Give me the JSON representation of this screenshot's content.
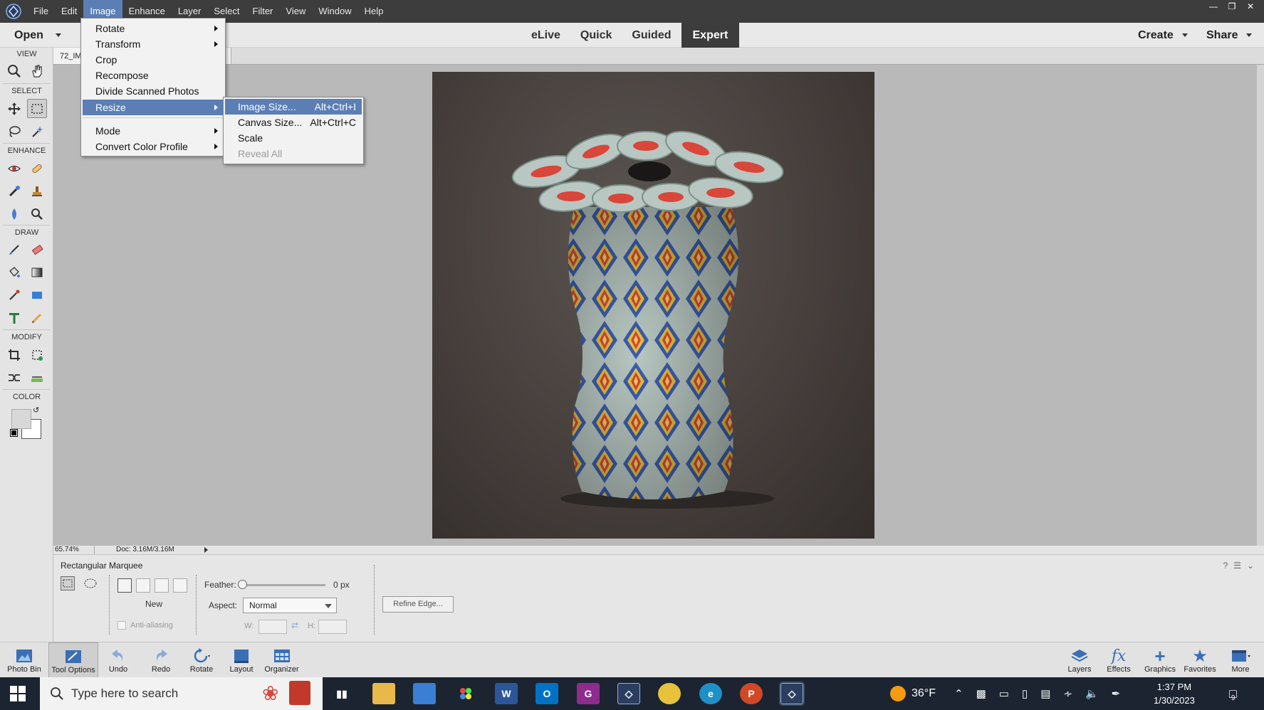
{
  "menubar": {
    "items": [
      "File",
      "Edit",
      "Image",
      "Enhance",
      "Layer",
      "Select",
      "Filter",
      "View",
      "Window",
      "Help"
    ],
    "active": "Image"
  },
  "modebar": {
    "open_label": "Open",
    "modes": [
      "eLive",
      "Quick",
      "Guided",
      "Expert"
    ],
    "active_mode": "Expert",
    "create_label": "Create",
    "share_label": "Share"
  },
  "toolbox": {
    "sections": {
      "view": "VIEW",
      "select": "SELECT",
      "enhance": "ENHANCE",
      "draw": "DRAW",
      "modify": "MODIFY",
      "color": "COLOR"
    }
  },
  "document": {
    "tab_label": "72_IM",
    "zoom": "65.74%",
    "doc_info": "Doc: 3.16M/3.16M"
  },
  "image_menu": {
    "items": [
      {
        "label": "Rotate",
        "submenu": true
      },
      {
        "label": "Transform",
        "submenu": true
      },
      {
        "label": "Crop",
        "submenu": false
      },
      {
        "label": "Recompose",
        "submenu": false
      },
      {
        "label": "Divide Scanned Photos",
        "submenu": false
      },
      {
        "label": "Resize",
        "submenu": true,
        "highlighted": true
      },
      {
        "label": "Mode",
        "submenu": true
      },
      {
        "label": "Convert Color Profile",
        "submenu": true
      }
    ]
  },
  "resize_menu": {
    "items": [
      {
        "label": "Image Size...",
        "shortcut": "Alt+Ctrl+I",
        "highlighted": true
      },
      {
        "label": "Canvas Size...",
        "shortcut": "Alt+Ctrl+C"
      },
      {
        "label": "Scale",
        "shortcut": ""
      },
      {
        "label": "Reveal All",
        "shortcut": "",
        "disabled": true
      }
    ]
  },
  "tool_options": {
    "tool_name": "Rectangular Marquee",
    "new_label": "New",
    "anti_alias_label": "Anti-aliasing",
    "feather_label": "Feather:",
    "feather_value": "0 px",
    "aspect_label": "Aspect:",
    "aspect_value": "Normal",
    "w_label": "W:",
    "h_label": "H:",
    "refine_label": "Refine Edge..."
  },
  "panelbar": {
    "left": [
      "Photo Bin",
      "Tool Options",
      "Undo",
      "Redo",
      "Rotate",
      "Layout",
      "Organizer"
    ],
    "right": [
      "Layers",
      "Effects",
      "Graphics",
      "Favorites",
      "More"
    ]
  },
  "taskbar": {
    "search_placeholder": "Type here to search",
    "temperature": "36°F",
    "time": "1:37 PM",
    "date": "1/30/2023",
    "notification_count": "9"
  },
  "colors": {
    "accent": "#5b7fb5",
    "menubar_bg": "#3d3d3d",
    "taskbar_bg": "#1b2430"
  }
}
